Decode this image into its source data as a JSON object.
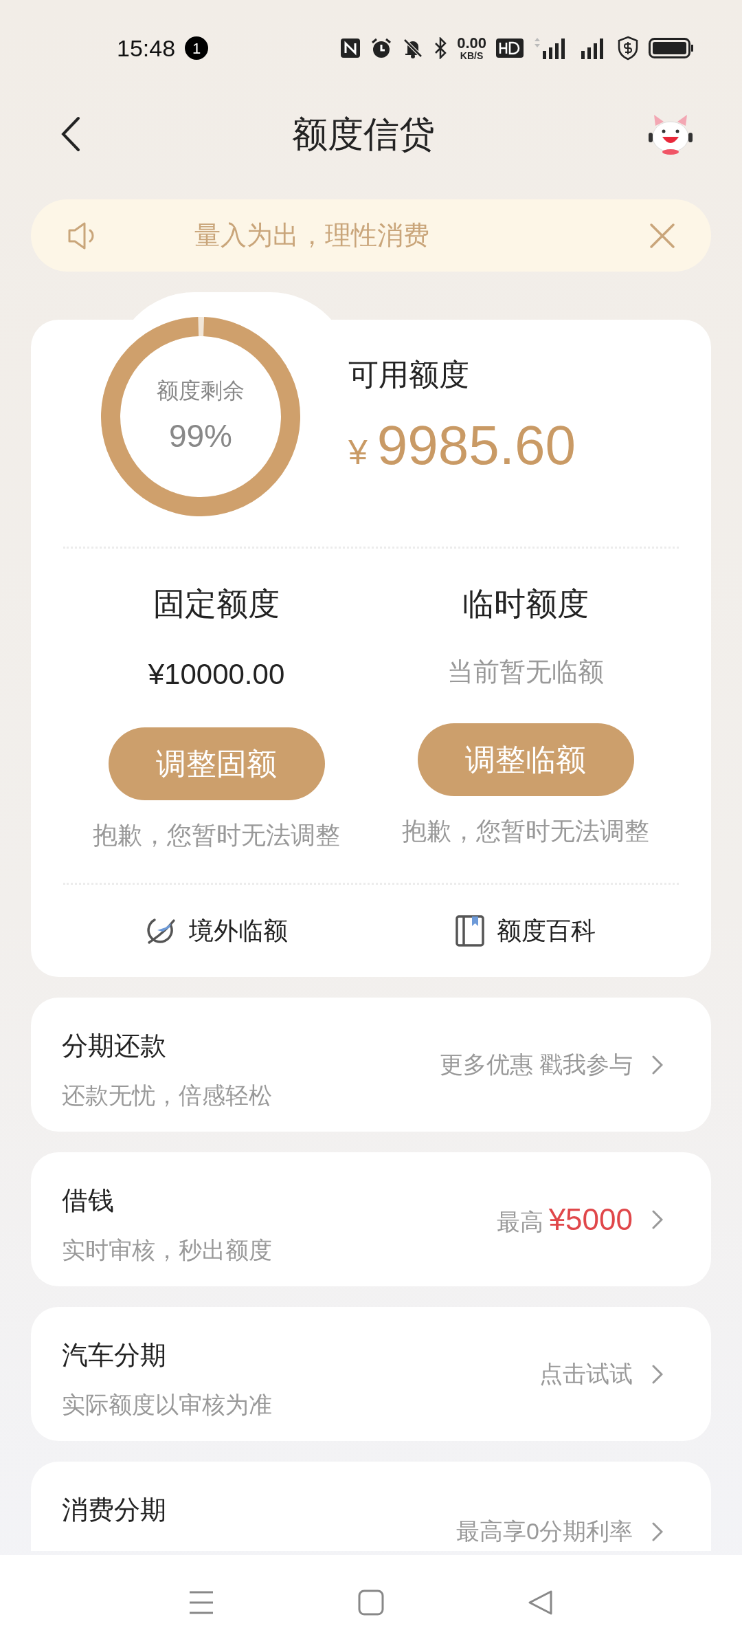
{
  "status_bar": {
    "time": "15:48",
    "notification_count": "1",
    "net_speed": "0.00",
    "net_unit": "KB/S"
  },
  "header": {
    "title": "额度信贷"
  },
  "notice": {
    "text": "量入为出，理性消费"
  },
  "quota": {
    "ring_label": "额度剩余",
    "ring_value": "99%",
    "level": 0.99,
    "available_label": "可用额度",
    "currency": "¥",
    "available_amount": "9985.60",
    "columns": [
      {
        "title": "固定额度",
        "value": "¥10000.00",
        "muted": false,
        "button": "调整固额",
        "note": "抱歉，您暂时无法调整"
      },
      {
        "title": "临时额度",
        "value": "当前暂无临额",
        "muted": true,
        "button": "调整临额",
        "note": "抱歉，您暂时无法调整"
      }
    ],
    "links": [
      {
        "kind": "plane",
        "label": "境外临额"
      },
      {
        "kind": "book",
        "label": "额度百科"
      }
    ]
  },
  "services": [
    {
      "title": "分期还款",
      "subtitle": "还款无忧，倍感轻松",
      "action": "更多优惠 戳我参与"
    },
    {
      "title": "借钱",
      "subtitle": "实时审核，秒出额度",
      "action_prefix": "最高",
      "action_highlight": "¥5000"
    },
    {
      "title": "汽车分期",
      "subtitle": "实际额度以审核为准",
      "action": "点击试试"
    },
    {
      "title": "消费分期",
      "action": "最高享0分期利率"
    }
  ]
}
